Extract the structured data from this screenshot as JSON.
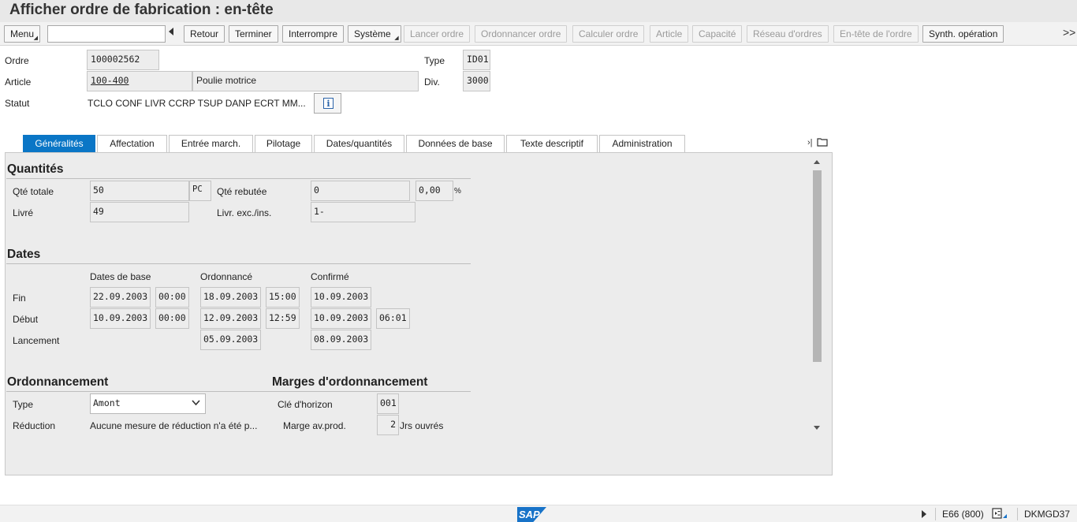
{
  "window": {
    "title": "Afficher ordre de fabrication : en-tête"
  },
  "toolbar": {
    "menu": "Menu",
    "command_value": "",
    "back": "Retour",
    "finish": "Terminer",
    "interrupt": "Interrompre",
    "system": "Système",
    "release_order": "Lancer ordre",
    "schedule_order": "Ordonnancer ordre",
    "calculate_order": "Calculer ordre",
    "article": "Article",
    "capacity": "Capacité",
    "order_network": "Réseau d'ordres",
    "order_header": "En-tête de l'ordre",
    "synth_op": "Synth. opération",
    "more": ">>"
  },
  "header": {
    "order_label": "Ordre",
    "order_value": "100002562",
    "type_label": "Type",
    "type_value": "ID01",
    "article_label": "Article",
    "article_value": "100-400",
    "article_desc": "Poulie motrice",
    "div_label": "Div.",
    "div_value": "3000",
    "status_label": "Statut",
    "status_value": "TCLO CONF LIVR CCRP TSUP DANP ECRT MM..."
  },
  "tabs": [
    {
      "label": "Généralités",
      "active": true
    },
    {
      "label": "Affectation"
    },
    {
      "label": "Entrée march."
    },
    {
      "label": "Pilotage"
    },
    {
      "label": "Dates/quantités"
    },
    {
      "label": "Données de base"
    },
    {
      "label": "Texte descriptif"
    },
    {
      "label": "Administration"
    }
  ],
  "quantities": {
    "title": "Quantités",
    "total_label": "Qté totale",
    "total_value": "50",
    "unit": "PC",
    "scrap_label": "Qté rebutée",
    "scrap_value": "0",
    "scrap_pct": "0,00",
    "pct_sign": "%",
    "delivered_label": "Livré",
    "delivered_value": "49",
    "excess_label": "Livr. exc./ins.",
    "excess_value": "1-"
  },
  "dates": {
    "title": "Dates",
    "col_base": "Dates de base",
    "col_scheduled": "Ordonnancé",
    "col_confirmed": "Confirmé",
    "end_label": "Fin",
    "start_label": "Début",
    "release_label": "Lancement",
    "end_base_date": "22.09.2003",
    "end_base_time": "00:00",
    "end_sched_date": "18.09.2003",
    "end_sched_time": "15:00",
    "end_conf_date": "10.09.2003",
    "start_base_date": "10.09.2003",
    "start_base_time": "00:00",
    "start_sched_date": "12.09.2003",
    "start_sched_time": "12:59",
    "start_conf_date": "10.09.2003",
    "start_conf_time": "06:01",
    "release_sched_date": "05.09.2003",
    "release_conf_date": "08.09.2003"
  },
  "scheduling": {
    "title": "Ordonnancement",
    "type_label": "Type",
    "type_value": "Amont",
    "reduction_label": "Réduction",
    "reduction_value": "Aucune mesure de réduction n'a été p..."
  },
  "margins": {
    "title": "Marges d'ordonnancement",
    "horizon_label": "Clé d'horizon",
    "horizon_value": "001",
    "margin_label": "Marge av.prod.",
    "margin_value": "2",
    "margin_unit": "Jrs ouvrés"
  },
  "statusbar": {
    "logo": "SAP",
    "system": "E66 (800)",
    "server": "DKMGD37"
  },
  "colors": {
    "accent": "#0a76c6",
    "field_bg": "#ededed",
    "panel_bg": "#ececec"
  }
}
